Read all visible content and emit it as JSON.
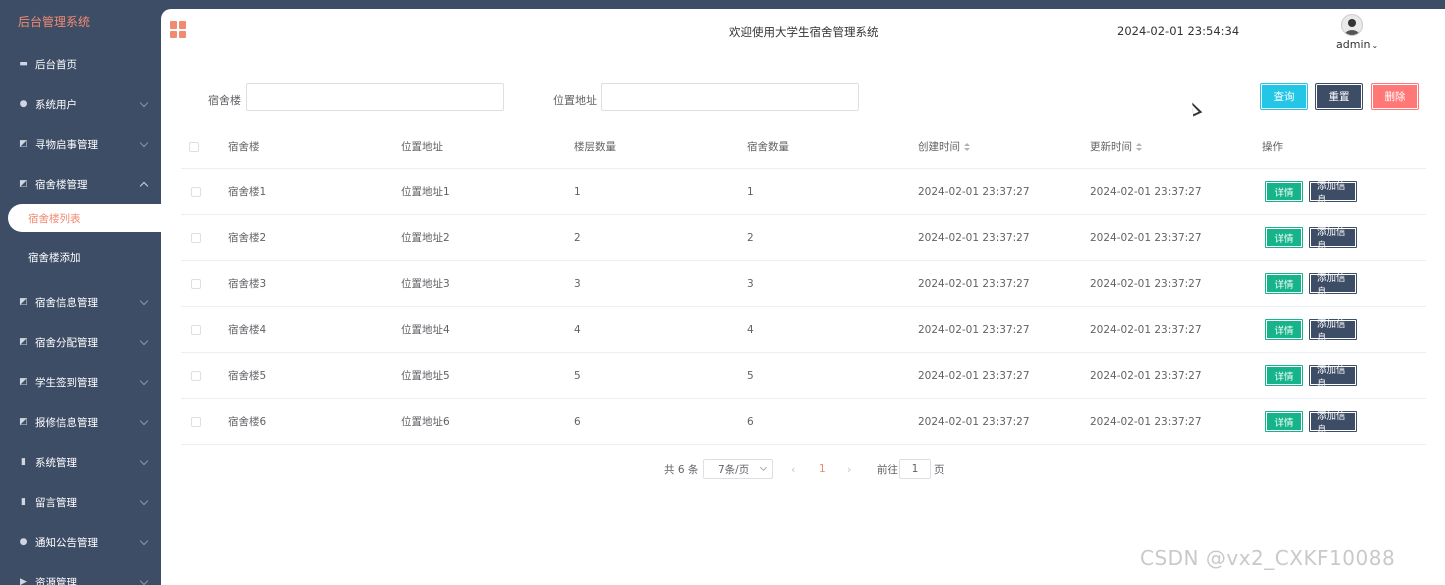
{
  "sidebar": {
    "brand": "后台管理系统",
    "items": [
      {
        "label": "后台首页",
        "icon": "monitor-icon",
        "has_arrow": false
      },
      {
        "label": "系统用户",
        "icon": "user-icon",
        "has_arrow": true
      },
      {
        "label": "寻物启事管理",
        "icon": "chart-icon",
        "has_arrow": true
      },
      {
        "label": "宿舍楼管理",
        "icon": "chart-icon",
        "has_arrow": true,
        "expanded": true
      },
      {
        "label": "宿舍信息管理",
        "icon": "chart-icon",
        "has_arrow": true
      },
      {
        "label": "宿舍分配管理",
        "icon": "chart-icon",
        "has_arrow": true
      },
      {
        "label": "学生签到管理",
        "icon": "chart-icon",
        "has_arrow": true
      },
      {
        "label": "报修信息管理",
        "icon": "chart-icon",
        "has_arrow": true
      },
      {
        "label": "系统管理",
        "icon": "bar-chart-icon",
        "has_arrow": true
      },
      {
        "label": "留言管理",
        "icon": "bar-chart-icon",
        "has_arrow": true
      },
      {
        "label": "通知公告管理",
        "icon": "info-icon",
        "has_arrow": true
      },
      {
        "label": "资源管理",
        "icon": "flag-icon",
        "has_arrow": true
      }
    ],
    "submenu": [
      {
        "label": "宿舍楼列表",
        "selected": true
      },
      {
        "label": "宿舍楼添加",
        "selected": false
      }
    ]
  },
  "header": {
    "welcome": "欢迎使用大学生宿舍管理系统",
    "datetime": "2024-02-01 23:54:34",
    "username": "admin"
  },
  "search": {
    "building_label": "宿舍楼",
    "building_value": "",
    "address_label": "位置地址",
    "address_value": "",
    "query_label": "查询",
    "reset_label": "重置",
    "delete_label": "删除"
  },
  "table": {
    "columns": [
      "宿舍楼",
      "位置地址",
      "楼层数量",
      "宿舍数量",
      "创建时间",
      "更新时间",
      "操作"
    ],
    "rows": [
      {
        "building": "宿舍楼1",
        "address": "位置地址1",
        "floors": "1",
        "rooms": "1",
        "created": "2024-02-01 23:37:27",
        "updated": "2024-02-01 23:37:27"
      },
      {
        "building": "宿舍楼2",
        "address": "位置地址2",
        "floors": "2",
        "rooms": "2",
        "created": "2024-02-01 23:37:27",
        "updated": "2024-02-01 23:37:27"
      },
      {
        "building": "宿舍楼3",
        "address": "位置地址3",
        "floors": "3",
        "rooms": "3",
        "created": "2024-02-01 23:37:27",
        "updated": "2024-02-01 23:37:27"
      },
      {
        "building": "宿舍楼4",
        "address": "位置地址4",
        "floors": "4",
        "rooms": "4",
        "created": "2024-02-01 23:37:27",
        "updated": "2024-02-01 23:37:27"
      },
      {
        "building": "宿舍楼5",
        "address": "位置地址5",
        "floors": "5",
        "rooms": "5",
        "created": "2024-02-01 23:37:27",
        "updated": "2024-02-01 23:37:27"
      },
      {
        "building": "宿舍楼6",
        "address": "位置地址6",
        "floors": "6",
        "rooms": "6",
        "created": "2024-02-01 23:37:27",
        "updated": "2024-02-01 23:37:27"
      }
    ],
    "detail_label": "详情",
    "add_info_label": "添加信息"
  },
  "pagination": {
    "total_text": "共 6 条",
    "page_size": "7条/页",
    "prev": "‹",
    "current_page": "1",
    "next": "›",
    "goto_label": "前往",
    "goto_value": "1",
    "page_unit": "页"
  },
  "watermark": "CSDN @vx2_CXKF10088",
  "colors": {
    "sidebar_bg": "#3e4d66",
    "accent": "#f08a71",
    "query_btn": "#23c6e6",
    "delete_btn": "#ff7777",
    "detail_btn": "#17b38a"
  }
}
